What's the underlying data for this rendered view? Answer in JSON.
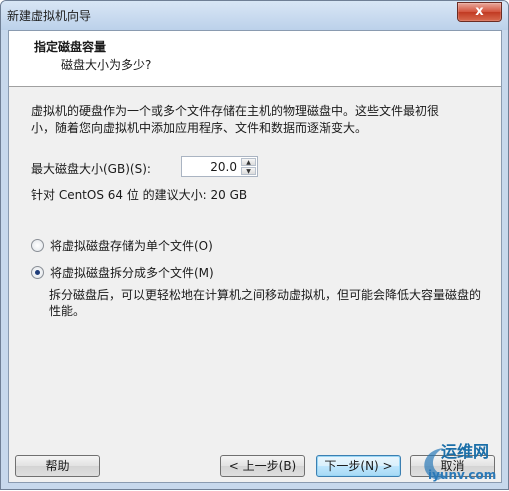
{
  "window": {
    "title": "新建虚拟机向导",
    "close_glyph": "x"
  },
  "header": {
    "title": "指定磁盘容量",
    "subtitle": "磁盘大小为多少?"
  },
  "description": {
    "line1": "虚拟机的硬盘作为一个或多个文件存储在主机的物理磁盘中。这些文件最初很",
    "line2": "小，随着您向虚拟机中添加应用程序、文件和数据而逐渐变大。"
  },
  "disk_size": {
    "label": "最大磁盘大小(GB)(S):",
    "value": "20.0",
    "up_glyph": "▲",
    "down_glyph": "▼",
    "recommended": "针对 CentOS 64 位 的建议大小: 20 GB"
  },
  "storage_options": {
    "single_file": "将虚拟磁盘存储为单个文件(O)",
    "multi_file": "将虚拟磁盘拆分成多个文件(M)",
    "selected": "multi_file",
    "split_desc_line1": "拆分磁盘后，可以更轻松地在计算机之间移动虚拟机，但可能会降低大容量磁盘的",
    "split_desc_line2": "性能。"
  },
  "buttons": {
    "help": "帮助",
    "back": "< 上一步(B)",
    "next": "下一步(N) >",
    "cancel": "取消"
  },
  "watermark": {
    "text1": "运维网",
    "text2": "iyunv.com"
  }
}
